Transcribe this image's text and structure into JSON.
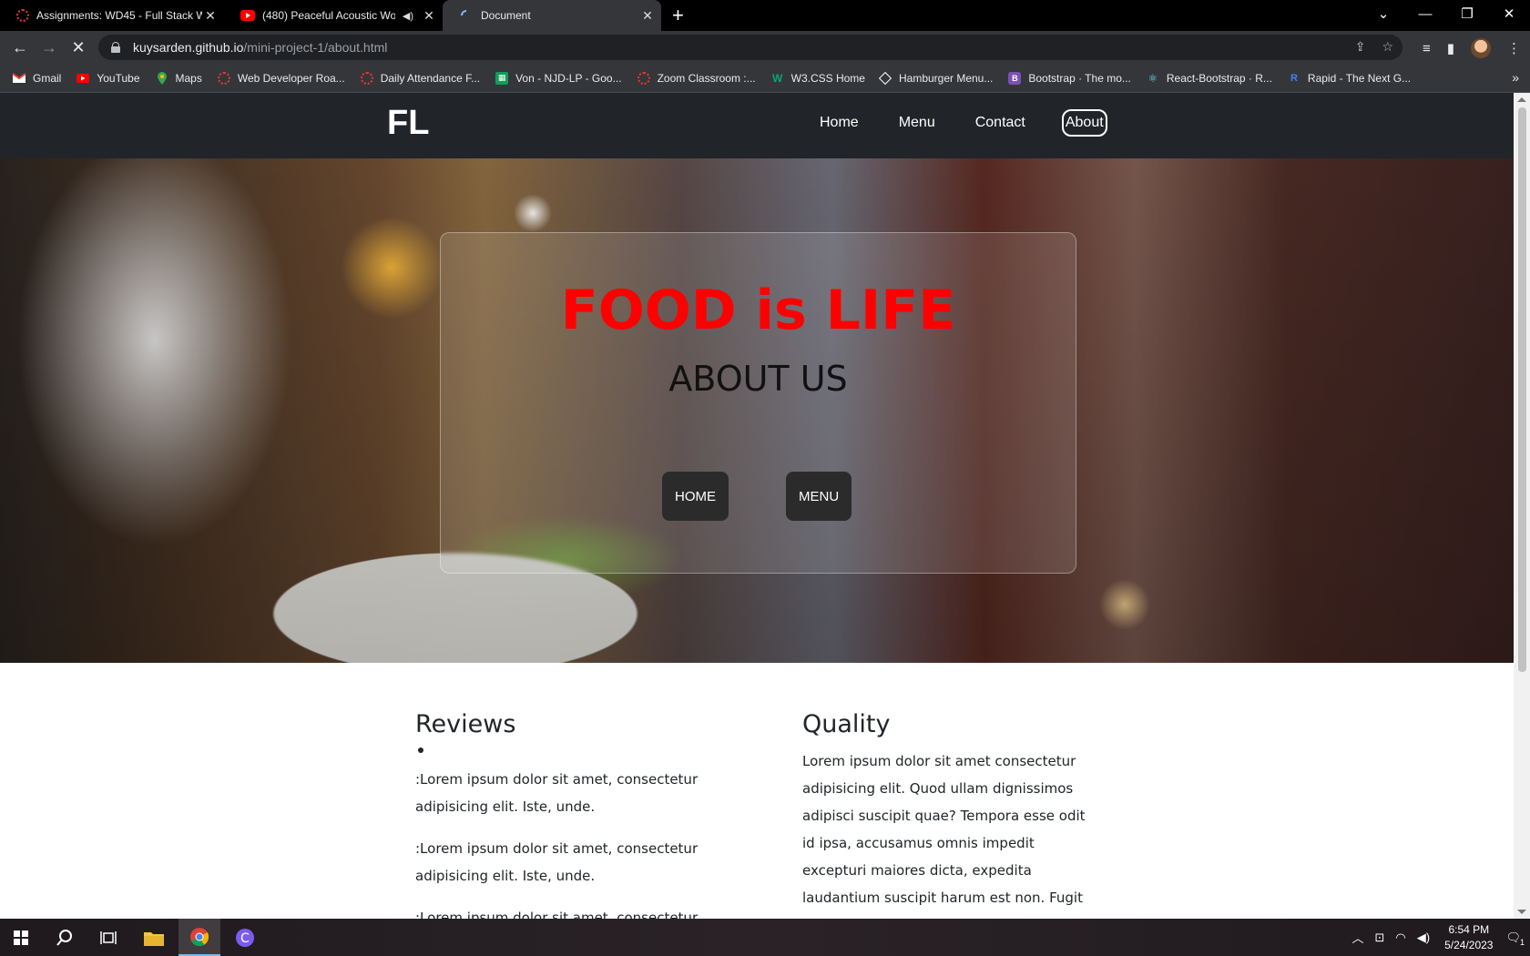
{
  "browser": {
    "tabs": [
      {
        "title": "Assignments: WD45 - Full Stack W",
        "close": "✕"
      },
      {
        "title": "(480) Peaceful Acoustic Wor",
        "close": "✕"
      },
      {
        "title": "Document",
        "close": "✕"
      }
    ],
    "new_tab": "+",
    "url_host": "kuysarden.github.io",
    "url_path": "/mini-project-1/about.html",
    "bookmarks": [
      {
        "label": "Gmail",
        "icon": "gmail-icon"
      },
      {
        "label": "YouTube",
        "icon": "youtube-icon"
      },
      {
        "label": "Maps",
        "icon": "maps-icon"
      },
      {
        "label": "Web Developer Roa...",
        "icon": "globe-ring-icon"
      },
      {
        "label": "Daily Attendance F...",
        "icon": "globe-ring-icon"
      },
      {
        "label": "Von - NJD-LP - Goo...",
        "icon": "sheets-icon"
      },
      {
        "label": "Zoom Classroom :...",
        "icon": "globe-ring-icon"
      },
      {
        "label": "W3.CSS Home",
        "icon": "w3-icon"
      },
      {
        "label": "Hamburger Menu...",
        "icon": "codepen-icon"
      },
      {
        "label": "Bootstrap · The mo...",
        "icon": "bootstrap-icon"
      },
      {
        "label": "React-Bootstrap · R...",
        "icon": "react-bootstrap-icon"
      },
      {
        "label": "Rapid - The Next G...",
        "icon": "rapid-icon"
      }
    ],
    "bookmarks_more": "»"
  },
  "site": {
    "brand": "FL",
    "nav": [
      "Home",
      "Menu",
      "Contact",
      "About"
    ],
    "hero_title": "FOOD is LIFE",
    "hero_subtitle": "ABOUT US",
    "hero_buttons": [
      "HOME",
      "MENU"
    ]
  },
  "content": {
    "reviews_title": "Reviews",
    "reviews": [
      ":Lorem ipsum dolor sit amet, consectetur adipisicing elit. Iste, unde.",
      ":Lorem ipsum dolor sit amet, consectetur adipisicing elit. Iste, unde.",
      ":Lorem ipsum dolor sit amet, consectetur"
    ],
    "quality_title": "Quality",
    "quality_text": "Lorem ipsum dolor sit amet consectetur adipisicing elit. Quod ullam dignissimos adipisci suscipit quae? Tempora esse odit id ipsa, accusamus omnis impedit excepturi maiores dicta, expedita laudantium suscipit harum est non. Fugit itaque voluptatem"
  },
  "taskbar": {
    "time": "6:54 PM",
    "date": "5/24/2023",
    "notifications": "1"
  },
  "colors": {
    "accent_red": "#ff0000",
    "nav_bg": "#212529",
    "chrome_bg": "#35363a"
  }
}
